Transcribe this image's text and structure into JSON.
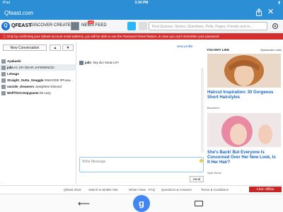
{
  "status": {
    "carrier": "iPad",
    "time": "3:34 PM",
    "battery": "▮"
  },
  "browser": {
    "url": "Qfeast.com",
    "close": "✕"
  },
  "header": {
    "logo_letter": "Q",
    "brand": "QFEAST",
    "nav": [
      "DISCOVER",
      "CREATE",
      "NEWS FEED"
    ],
    "badge": "149",
    "search_placeholder": "Find Quizzes, Stories, Questions, Polls, Pages, Friends and m..."
  },
  "alert": {
    "prefix": "Only by confirming your Qfeast account email address, you will be able to use the ",
    "emph": "Password Reset",
    "suffix": " feature, in case you can't remember your password"
  },
  "conversations": {
    "new_label": "New Conversation",
    "up": "▲",
    "down": "▼",
    "items": [
      {
        "name": "Ayakashi",
        "preview": ""
      },
      {
        "name": "jalin",
        "preview": "Hi, MY DEAR JAFERENCE!"
      },
      {
        "name": "Leleago",
        "preview": ""
      },
      {
        "name": "Straight_Outta_Snuggle",
        "preview": "SNUGGIE #Prosa..."
      },
      {
        "name": "suicide_dreamers",
        "preview": "Josephine Dimond"
      },
      {
        "name": "WolfTheCreepypasta",
        "preview": "Mr Lazy"
      }
    ]
  },
  "chat": {
    "view_profile": "view profile",
    "message_author": "jalin",
    "message_text": "hey do i know u?!!",
    "write_placeholder": "Write Message",
    "send": "Send"
  },
  "sponsored": {
    "heading": "YOU MAY LIKE",
    "label": "Sponsored Links",
    "ads": [
      {
        "title": "Haircut Inspiration: 30 Gorgeous Short Hairstyles",
        "source": "Buzzhunt"
      },
      {
        "title": "She's Back! But Everyone Is Concerned Over Her New Look, Is It Her Hair?",
        "source": "Spot Some"
      }
    ]
  },
  "footer": {
    "links": [
      "Qfeast 2016",
      "Switch to Mobile Site",
      "What's New",
      "FAQ",
      "Questions & Answers",
      "Terms & Conditions",
      "Privacy Polic..."
    ],
    "chat_offline": "Chat: Offline"
  },
  "navbar": {
    "back": "⟵",
    "google": "g"
  }
}
